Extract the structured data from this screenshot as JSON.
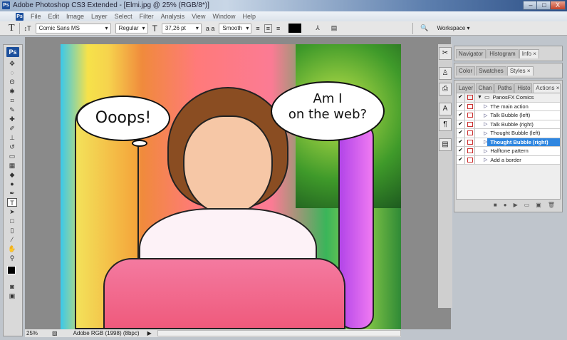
{
  "window": {
    "title": "Adobe Photoshop CS3 Extended - [Elmi.jpg @ 25% (RGB/8*)]",
    "logo": "Ps",
    "minimize": "–",
    "maximize": "□",
    "close": "X"
  },
  "menu": [
    "File",
    "Edit",
    "Image",
    "Layer",
    "Select",
    "Filter",
    "Analysis",
    "View",
    "Window",
    "Help"
  ],
  "options": {
    "tool": "T",
    "font_family": "Comic Sans MS",
    "font_style": "Regular",
    "font_size": "37,26 pt",
    "aa_label": "a a",
    "antialias": "Smooth",
    "workspace": "Workspace ▾"
  },
  "canvas": {
    "bubble_left": "Ooops!",
    "bubble_right_line1": "Am I",
    "bubble_right_line2": "on the web?"
  },
  "status": {
    "zoom": "25%",
    "profile": "Adobe RGB (1998) (8bpc)"
  },
  "panels": {
    "top_tabs": [
      "Navigator",
      "Histogram",
      "Info"
    ],
    "mid_tabs": [
      "Color",
      "Swatches",
      "Styles"
    ],
    "bottom_tabs": [
      "Layer",
      "Chan",
      "Paths",
      "Histo",
      "Actions"
    ],
    "action_set": "PanosFX Comics",
    "actions": [
      "The main action",
      "Talk Bubble (left)",
      "Talk Bubble (right)",
      "Thought Bubble (left)",
      "Thought Bubble (right)",
      "Halftone pattern",
      "Add a border"
    ],
    "selected_action": "Thought Bubble (right)"
  },
  "colors": {
    "selection": "#2f86e0",
    "titlebar": "#2c4f86"
  }
}
